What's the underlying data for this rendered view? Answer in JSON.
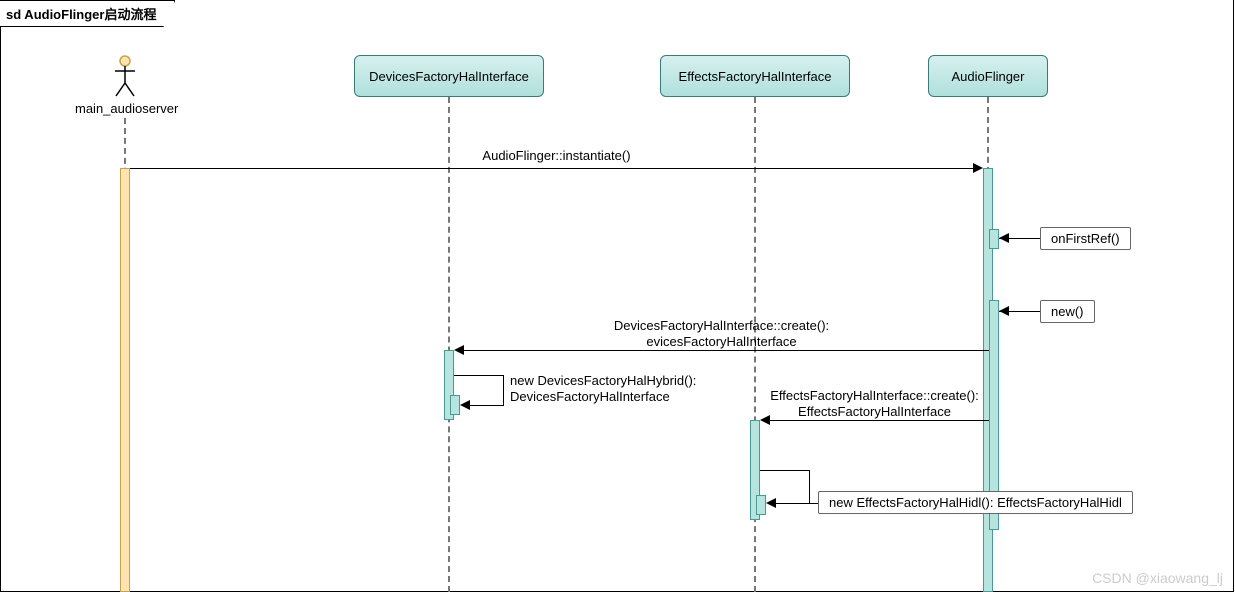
{
  "title": "sd AudioFlinger启动流程",
  "actor": {
    "name": "main_audioserver"
  },
  "participants": {
    "devices": "DevicesFactoryHalInterface",
    "effects": "EffectsFactoryHalInterface",
    "flinger": "AudioFlinger"
  },
  "messages": {
    "instantiate": "AudioFlinger::instantiate()",
    "onFirstRef": "onFirstRef()",
    "new": "new()",
    "devicesCreate1": "DevicesFactoryHalInterface::create():",
    "devicesCreate2": "evicesFactoryHalInterface",
    "devicesHybrid1": "new DevicesFactoryHalHybrid():",
    "devicesHybrid2": "DevicesFactoryHalInterface",
    "effectsCreate1": "EffectsFactoryHalInterface::create():",
    "effectsCreate2": "EffectsFactoryHalInterface",
    "effectsHidl": "new EffectsFactoryHalHidl(): EffectsFactoryHalHidl"
  },
  "watermark": "CSDN @xiaowang_lj"
}
